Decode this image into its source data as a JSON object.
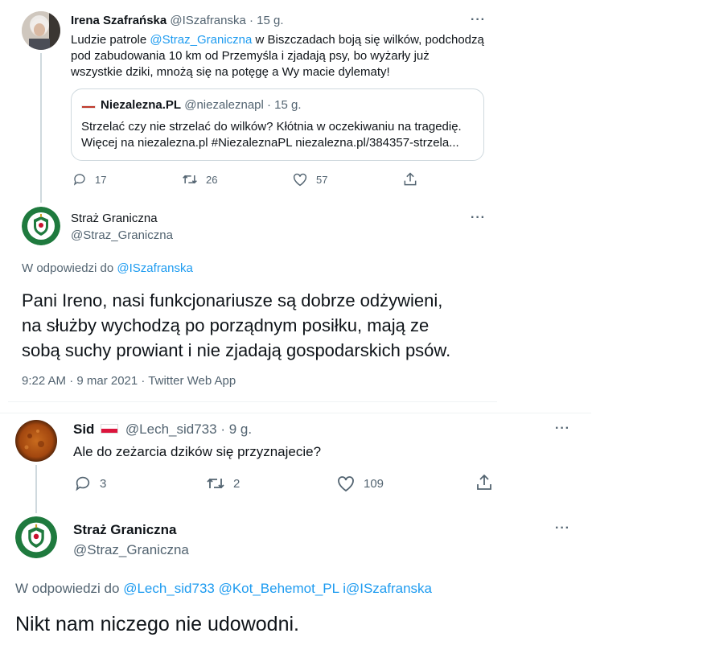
{
  "tweet1": {
    "author": "Irena Szafrańska",
    "handle": "@ISzafranska",
    "time": "· 15 g.",
    "text_line1_prefix": "Ludzie patrole ",
    "text_mention": "@Straz_Graniczna",
    "text_line1_suffix": " w Biszczadach boją się wilków, podchodzą",
    "text_line2": "pod zabudowania 10 km od Przemyśla i zjadają psy, bo wyżarły już",
    "text_line3": "wszystkie dziki, mnożą się na potęgę a Wy macie dylematy!",
    "quote": {
      "author": "Niezalezna.PL",
      "handle": "@niezaleznapl",
      "time": "· 15 g.",
      "line1": "Strzelać czy nie strzelać do wilków? Kłótnia w oczekiwaniu na tragedię.",
      "line2": "Więcej na niezalezna.pl #NiezaleznaPL niezalezna.pl/384357-strzela..."
    },
    "replies": "17",
    "retweets": "26",
    "likes": "57"
  },
  "reply1": {
    "author": "Straż Graniczna",
    "handle": "@Straz_Graniczna",
    "replying_prefix": "W odpowiedzi do ",
    "replying_to": "@ISzafranska",
    "line1": "Pani Ireno, nasi funkcjonariusze są dobrze odżywieni,",
    "line2": "na służby wychodzą po porządnym posiłku, mają ze",
    "line3": "sobą suchy prowiant i nie zjadają gospodarskich psów.",
    "meta": "9:22 AM · 9 mar 2021 · Twitter Web App"
  },
  "tweet2": {
    "author": "Sid",
    "handle": "@Lech_sid733",
    "time": "· 9 g.",
    "text": "Ale do zeżarcia dzików się przyznajecie?",
    "replies": "3",
    "retweets": "2",
    "likes": "109"
  },
  "reply2": {
    "author": "Straż Graniczna",
    "handle": "@Straz_Graniczna",
    "replying_prefix": "W odpowiedzi do ",
    "replying_to": "@Lech_sid733 @Kot_Behemot_PL i@ISzafranska",
    "text": "Nikt nam niczego nie udowodni."
  },
  "icons": {
    "reply": "reply-icon",
    "retweet": "retweet-icon",
    "like": "heart-icon",
    "share": "share-icon",
    "more": "more-icon",
    "flag": "poland-flag-icon"
  },
  "colors": {
    "link": "#1d9bf0",
    "muted": "#536471",
    "text": "#0f1419",
    "sg_green": "#1f7a3e"
  }
}
